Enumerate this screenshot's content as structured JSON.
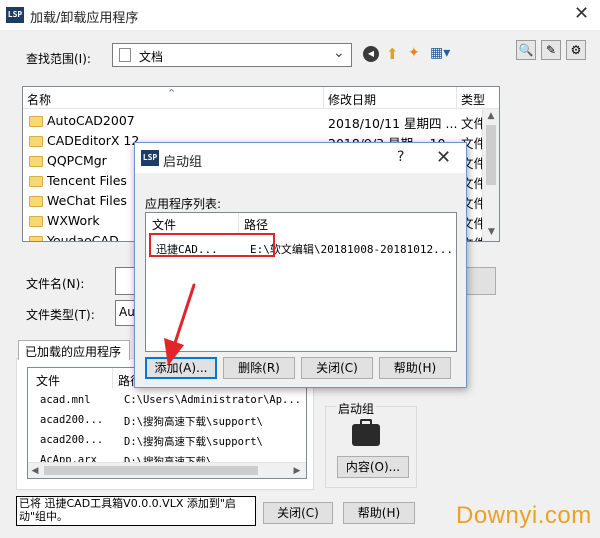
{
  "window": {
    "title": "加载/卸载应用程序",
    "icon_glyph": "LSP",
    "close_glyph": "✕"
  },
  "lookin": {
    "label": "查找范围(I):",
    "value": "文档",
    "dropdown_glyph": "⌄"
  },
  "toolbar": {
    "back_glyph": "◀",
    "up_glyph": "⬆",
    "newfolder_glyph": "✦",
    "views_glyph": "▦▾",
    "find_glyph": "🔍",
    "tools_glyph": "✎",
    "options_glyph": "⚙"
  },
  "file_list": {
    "columns": {
      "name": "名称",
      "modified": "修改日期",
      "type": "类型"
    },
    "sort_glyph": "⌃",
    "rows": [
      {
        "name": "AutoCAD2007",
        "date": "2018/10/11 星期四 ...",
        "type": "文件"
      },
      {
        "name": "CADEditorX 12",
        "date": "2018/9/3 星期一 10...",
        "type": "文件"
      },
      {
        "name": "QQPCMgr",
        "date": "",
        "type": "文件"
      },
      {
        "name": "Tencent Files",
        "date": "",
        "type": "文件"
      },
      {
        "name": "WeChat Files",
        "date": "",
        "type": "文件"
      },
      {
        "name": "WXWork",
        "date": "",
        "type": "文件"
      },
      {
        "name": "YoudaoCAD",
        "date": "",
        "type": "文件"
      }
    ]
  },
  "filename": {
    "label": "文件名(N):",
    "value": ""
  },
  "filetype": {
    "label": "文件类型(T):",
    "value": "Au"
  },
  "loaded_apps": {
    "tab_label": "已加载的应用程序",
    "columns": {
      "file": "文件",
      "path": "路径"
    },
    "rows": [
      {
        "file": "acad.mnl",
        "path": "C:\\Users\\Administrator\\Ap..."
      },
      {
        "file": "acad200...",
        "path": "D:\\搜狗高速下载\\support\\"
      },
      {
        "file": "acad200...",
        "path": "D:\\搜狗高速下载\\support\\"
      },
      {
        "file": "AcApp.arx",
        "path": "D:\\搜狗高速下载\\"
      }
    ]
  },
  "startup_group": {
    "label": "启动组",
    "contents_button": "内容(O)..."
  },
  "status": {
    "line1": "已将 迅捷CAD工具箱V0.0.0.VLX 添加到\"启",
    "line2": "动\"组中。"
  },
  "bottom_buttons": {
    "close": "关闭(C)",
    "help": "帮助(H)"
  },
  "startup_dialog": {
    "title": "启动组",
    "help_glyph": "?",
    "close_glyph": "✕",
    "list_label": "应用程序列表:",
    "columns": {
      "file": "文件",
      "path": "路径"
    },
    "rows": [
      {
        "file": "迅捷CAD...",
        "path": "E:\\软文编辑\\20181008-20181012..."
      }
    ],
    "buttons": {
      "add": "添加(A)...",
      "remove": "删除(R)",
      "close": "关闭(C)",
      "help": "帮助(H)"
    }
  },
  "watermark": "Downyi.com",
  "colors": {
    "highlight": "#e0262b",
    "accent": "#0078d7",
    "watermark": "#f0a020"
  }
}
